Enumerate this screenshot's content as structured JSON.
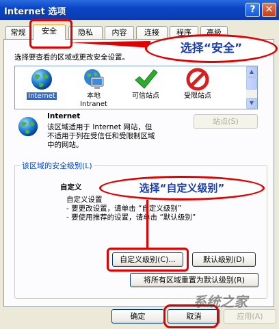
{
  "window": {
    "title": "Internet 选项",
    "help_label": "?",
    "close_label": "✕"
  },
  "tabs": [
    {
      "label": "常规"
    },
    {
      "label": "安全"
    },
    {
      "label": "隐私"
    },
    {
      "label": "内容"
    },
    {
      "label": "连接"
    },
    {
      "label": "程序"
    },
    {
      "label": "高级"
    }
  ],
  "zone_prompt": "选择要查看的区域或更改安全设置。",
  "zones": [
    {
      "label": "Internet",
      "icon": "globe-icon"
    },
    {
      "label_line1": "本地",
      "label_line2": "Intranet",
      "icon": "intranet-computer-icon"
    },
    {
      "label": "可信站点",
      "icon": "checkmark-icon"
    },
    {
      "label": "受限站点",
      "icon": "no-entry-icon"
    }
  ],
  "zone_info": {
    "name": "Internet",
    "desc1": "该区域适用于 Internet 网站，但",
    "desc2": "不适用于列在受信任和受限制区域",
    "desc3": "中的网站。",
    "sites_button": "站点(S)"
  },
  "security_level": {
    "group_label": "该区域的安全级别(L)",
    "level_name": "自定义",
    "line1": "自定义设置",
    "line2": "- 要更改设置，请单击 “自定义级别”",
    "line3": "- 要使用推荐的设置，请单击 “默认级别”",
    "custom_button": "自定义级别(C)...",
    "default_button": "默认级别(D)"
  },
  "reset_all_button": "将所有区域重置为默认级别(R)",
  "footer": {
    "ok": "确定",
    "cancel": "取消",
    "apply": "应用(A)"
  },
  "annotations": {
    "select_security": "选择“安全”",
    "select_custom": "选择“自定义级别”"
  },
  "watermark": "系统之家",
  "colors": {
    "titlebar": "#0a46c8",
    "annotation_red": "#e00000",
    "annotation_text": "#1b3fb0",
    "group_label": "#0046d5"
  }
}
